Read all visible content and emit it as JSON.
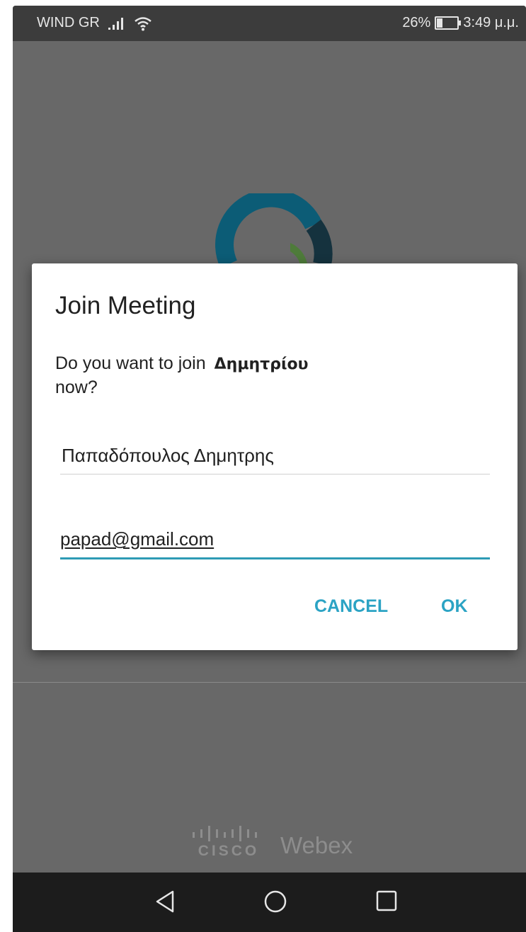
{
  "status_bar": {
    "carrier": "WIND GR",
    "battery_percent": "26%",
    "time": "3:49 μ.μ.",
    "battery_level": 0.26,
    "icons": [
      "signal-icon",
      "wifi-icon",
      "battery-icon"
    ]
  },
  "dialog": {
    "title": "Join Meeting",
    "message_prefix": "Do you want to join",
    "meeting_name": "Δημητρίου",
    "message_suffix": "now?",
    "name_value": "Παπαδόπουλος Δημητρης",
    "email_value": "papad@gmail.com",
    "cancel_label": "CANCEL",
    "ok_label": "OK"
  },
  "branding": {
    "cisco": "CISCO",
    "webex": "Webex"
  },
  "nav_bar": {
    "icons": [
      "back-icon",
      "home-icon",
      "recents-icon"
    ]
  },
  "colors": {
    "accent": "#2BA3C4",
    "overlay": "#686868",
    "dialog_bg": "#FFFFFF",
    "status_bar": "#3C3C3C",
    "nav_bar": "#1C1C1C"
  }
}
